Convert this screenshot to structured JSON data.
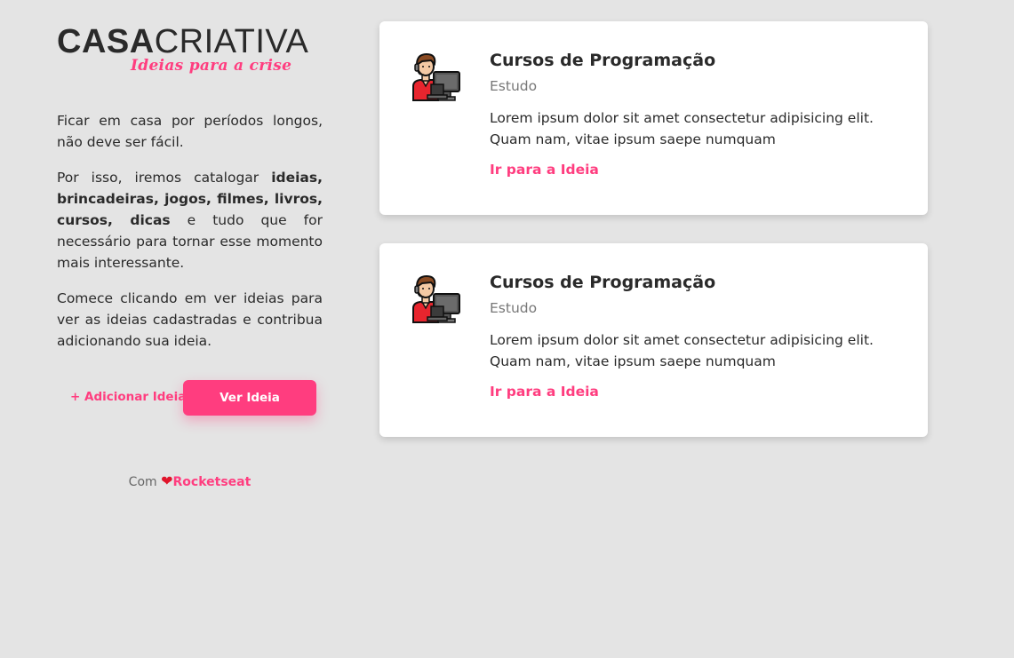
{
  "header": {
    "logo_part1": "CASA",
    "logo_part2": "CRIATIVA",
    "tagline": "Ideias para a crise"
  },
  "intro": {
    "p1": "Ficar em casa por períodos longos, não deve ser fácil.",
    "p2_before": "Por isso, iremos catalogar ",
    "p2_bold": "ideias, brincadeiras, jogos, filmes, livros, cursos, dicas",
    "p2_after": " e tudo que for necessário para tornar esse momento mais interessante.",
    "p3": "Comece clicando em ver ideias para ver as ideias cadastradas e contribua adicionando sua ideia."
  },
  "actions": {
    "add_label": "+ Adicionar Ideia",
    "view_label": "Ver Ideia"
  },
  "footer": {
    "prefix": "Com",
    "heart": "❤",
    "brand": "Rocketseat"
  },
  "ideas": [
    {
      "icon": "programmer-icon",
      "title": "Cursos de Programação",
      "category": "Estudo",
      "description": "Lorem ipsum dolor sit amet consectetur adipisicing elit. Quam nam, vitae ipsum saepe numquam",
      "link_label": "Ir para a Ideia"
    },
    {
      "icon": "programmer-icon",
      "title": "Cursos de Programação",
      "category": "Estudo",
      "description": "Lorem ipsum dolor sit amet consectetur adipisicing elit. Quam nam, vitae ipsum saepe numquam",
      "link_label": "Ir para a Ideia"
    }
  ],
  "colors": {
    "accent": "#ff3d7f",
    "background": "#e4e4e4",
    "card": "#ffffff",
    "text": "#2a2a2a"
  }
}
